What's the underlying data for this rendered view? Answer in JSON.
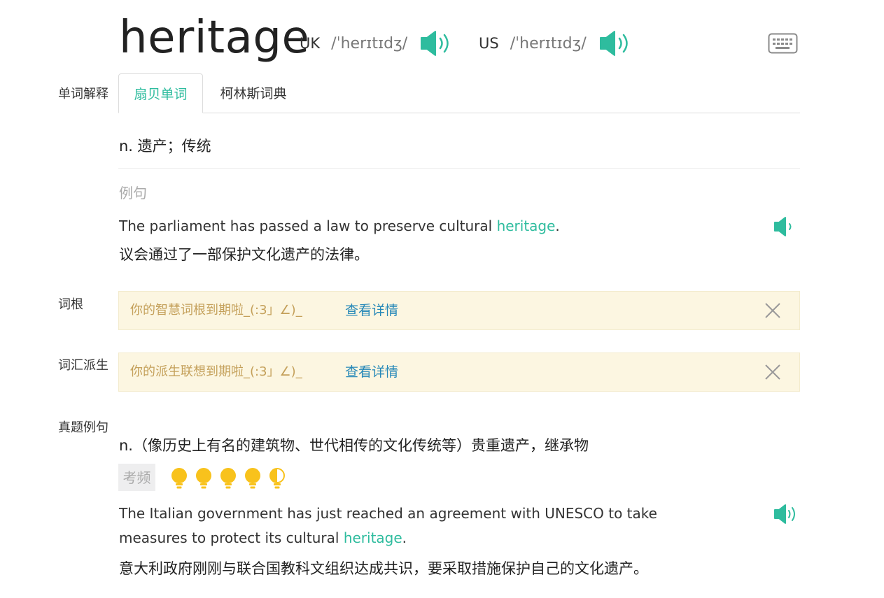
{
  "word": "heritage",
  "pronunciation": {
    "uk": {
      "region": "UK",
      "ipa": "/ˈherɪtɪdʒ/"
    },
    "us": {
      "region": "US",
      "ipa": "/ˈherɪtɪdʒ/"
    }
  },
  "labels": {
    "definition": "单词解释",
    "root": "词根",
    "derivation": "词汇派生",
    "exam_examples": "真题例句"
  },
  "tabs": [
    {
      "label": "扇贝单词",
      "active": true
    },
    {
      "label": "柯林斯词典",
      "active": false
    }
  ],
  "definition": "n. 遗产；传统",
  "example_section_label": "例句",
  "example": {
    "en_before": "The parliament has passed a law to preserve cultural ",
    "en_highlight": "heritage",
    "en_after": ".",
    "zh": "议会通过了一部保护文化遗产的法律。"
  },
  "root_notice": {
    "message": "你的智慧词根到期啦_(:3」∠)_",
    "link": "查看详情"
  },
  "derivation_notice": {
    "message": "你的派生联想到期啦_(:3」∠)_",
    "link": "查看详情"
  },
  "exam": {
    "definition": "n.（像历史上有名的建筑物、世代相传的文化传统等）贵重遗产，继承物",
    "frequency_label": "考频",
    "frequency_rating": 4.5,
    "frequency_max": 5,
    "en_line1": "The Italian government has just reached an agreement with UNESCO to take",
    "en_line2_before": "measures to protect its cultural ",
    "en_highlight": "heritage",
    "en_line2_after": ".",
    "zh": "意大利政府刚刚与联合国教科文组织达成共识，要采取措施保护自己的文化遗产。"
  },
  "colors": {
    "accent": "#2ebc9e",
    "notice_bg": "#fcf6e1",
    "notice_text": "#c4a05a",
    "link": "#2688b8",
    "bulb": "#f8c21c"
  }
}
